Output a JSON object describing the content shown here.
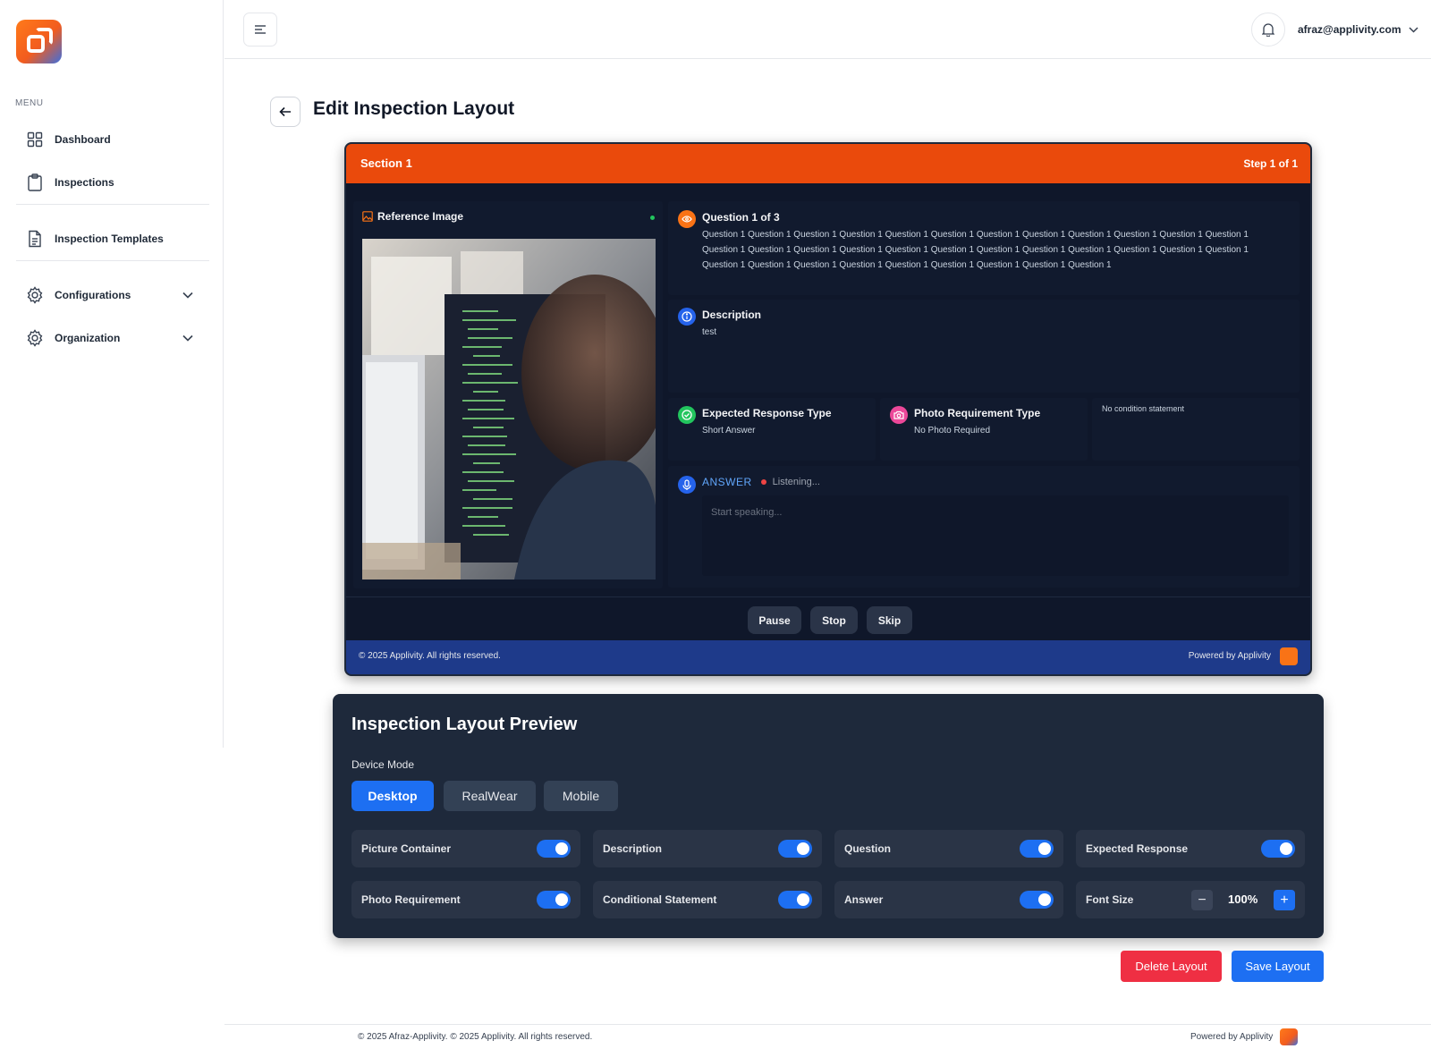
{
  "sidebar": {
    "menu_label": "MENU",
    "items": [
      {
        "label": "Dashboard",
        "icon": "grid-icon"
      },
      {
        "label": "Inspections",
        "icon": "clipboard-icon"
      },
      {
        "label": "Inspection Templates",
        "icon": "document-icon"
      },
      {
        "label": "Configurations",
        "icon": "gear-icon"
      },
      {
        "label": "Organization",
        "icon": "gear-icon"
      }
    ]
  },
  "header": {
    "user_email": "afraz@applivity.com"
  },
  "page": {
    "title": "Edit Inspection Layout"
  },
  "screen": {
    "section_title": "Section 1",
    "step": "Step 1 of 1",
    "reference_image_title": "Reference Image",
    "question_title": "Question 1 of 3",
    "question_text": "Question 1 Question 1 Question 1 Question 1 Question 1 Question 1 Question 1 Question 1 Question 1 Question 1 Question 1 Question 1 Question 1 Question 1 Question 1 Question 1 Question 1 Question 1 Question 1 Question 1 Question 1 Question 1 Question 1 Question 1 Question 1 Question 1 Question 1 Question 1 Question 1 Question 1 Question 1 Question 1 Question 1",
    "description_title": "Description",
    "description_text": "test",
    "expected_response_title": "Expected Response Type",
    "expected_response_value": "Short Answer",
    "photo_requirement_title": "Photo Requirement Type",
    "photo_requirement_value": "No Photo Required",
    "condition_text": "No condition statement",
    "answer_label": "ANSWER",
    "listening": "Listening...",
    "answer_placeholder": "Start speaking...",
    "controls": {
      "pause": "Pause",
      "stop": "Stop",
      "skip": "Skip"
    },
    "footer_copyright": "© 2025 Applivity. All rights reserved.",
    "footer_powered": "Powered by Applivity"
  },
  "preview": {
    "title": "Inspection Layout Preview",
    "device_mode_label": "Device Mode",
    "devices": [
      "Desktop",
      "RealWear",
      "Mobile"
    ],
    "active_device": "Desktop",
    "options": [
      {
        "label": "Picture Container",
        "enabled": true
      },
      {
        "label": "Description",
        "enabled": true
      },
      {
        "label": "Question",
        "enabled": true
      },
      {
        "label": "Expected Response",
        "enabled": true
      },
      {
        "label": "Photo Requirement",
        "enabled": true
      },
      {
        "label": "Conditional Statement",
        "enabled": true
      },
      {
        "label": "Answer",
        "enabled": true
      }
    ],
    "font_size_label": "Font Size",
    "font_size_value": "100%",
    "font_minus": "−",
    "font_plus": "+"
  },
  "actions": {
    "delete": "Delete Layout",
    "save": "Save Layout"
  },
  "footer": {
    "copyright": "© 2025 Afraz-Applivity. © 2025 Applivity. All rights reserved.",
    "powered": "Powered by Applivity"
  },
  "colors": {
    "accent": "#ea4a0c",
    "primary": "#1d6ff2",
    "danger": "#ef2f43",
    "dark_bg": "#0f172a",
    "card_bg": "#1e293b"
  }
}
